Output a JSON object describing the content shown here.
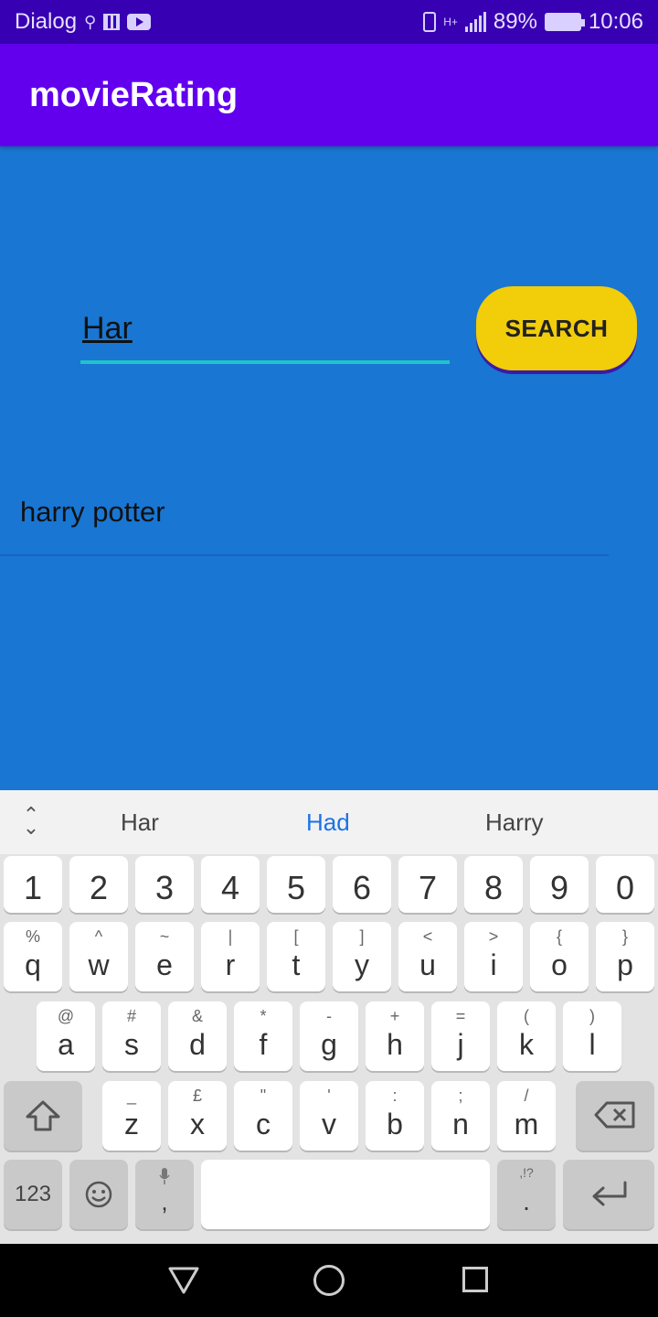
{
  "status_bar": {
    "carrier": "Dialog",
    "battery": "89%",
    "time": "10:06",
    "network": "H+"
  },
  "app_bar": {
    "title": "movieRating"
  },
  "search": {
    "value": "Har",
    "button_label": "SEARCH"
  },
  "results": [
    {
      "title": "harry potter"
    }
  ],
  "keyboard": {
    "suggestions": [
      "Har",
      "Had",
      "Harry"
    ],
    "row_numbers": [
      "1",
      "2",
      "3",
      "4",
      "5",
      "6",
      "7",
      "8",
      "9",
      "0"
    ],
    "row1": [
      {
        "main": "q",
        "sub": "%"
      },
      {
        "main": "w",
        "sub": "^"
      },
      {
        "main": "e",
        "sub": "~"
      },
      {
        "main": "r",
        "sub": "|"
      },
      {
        "main": "t",
        "sub": "["
      },
      {
        "main": "y",
        "sub": "]"
      },
      {
        "main": "u",
        "sub": "<"
      },
      {
        "main": "i",
        "sub": ">"
      },
      {
        "main": "o",
        "sub": "{"
      },
      {
        "main": "p",
        "sub": "}"
      }
    ],
    "row2": [
      {
        "main": "a",
        "sub": "@"
      },
      {
        "main": "s",
        "sub": "#"
      },
      {
        "main": "d",
        "sub": "&"
      },
      {
        "main": "f",
        "sub": "*"
      },
      {
        "main": "g",
        "sub": "-"
      },
      {
        "main": "h",
        "sub": "+"
      },
      {
        "main": "j",
        "sub": "="
      },
      {
        "main": "k",
        "sub": "("
      },
      {
        "main": "l",
        "sub": ")"
      }
    ],
    "row3": [
      {
        "main": "z",
        "sub": "_"
      },
      {
        "main": "x",
        "sub": "£"
      },
      {
        "main": "c",
        "sub": "\""
      },
      {
        "main": "v",
        "sub": "'"
      },
      {
        "main": "b",
        "sub": ":"
      },
      {
        "main": "n",
        "sub": ";"
      },
      {
        "main": "m",
        "sub": "/"
      }
    ],
    "numbers_key": "123",
    "comma_key": ",",
    "period_key": ".",
    "period_sub": ",!?"
  },
  "icons": {
    "usb": "usb-icon",
    "qr": "qr-icon",
    "youtube": "youtube-icon",
    "vibrate": "vibrate-icon",
    "signal": "signal-icon",
    "battery": "battery-icon",
    "shift": "shift-icon",
    "backspace": "backspace-icon",
    "emoji": "emoji-icon",
    "mic": "mic-icon",
    "enter": "enter-icon",
    "expand": "expand-icon",
    "nav_back": "back-icon",
    "nav_home": "home-icon",
    "nav_recent": "recent-apps-icon"
  },
  "colors": {
    "status_bar": "#3700b3",
    "app_bar": "#6200ee",
    "background": "#1976d2",
    "accent_underline": "#20c4c8",
    "search_button": "#f2cd0a",
    "suggestion_selected": "#1a73e8"
  }
}
